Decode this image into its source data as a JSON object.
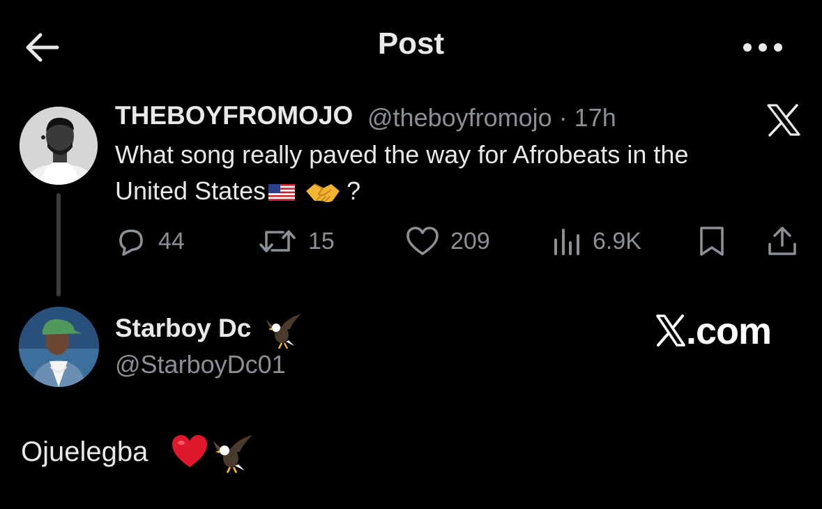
{
  "header": {
    "back_icon": "arrow-left-icon",
    "title": "Post",
    "more_icon": "more-horizontal-icon"
  },
  "parent_post": {
    "display_name": "THEBOYFROMOJO",
    "handle_time": "@theboyfromojo · 17h",
    "text_line1": "What song really paved the way for Afrobeats in the",
    "text_line2_start": "United States",
    "text_line2_end": "?",
    "emojis": [
      "us-flag-icon",
      "handshake-icon"
    ],
    "platform_icon": "x-logo-icon",
    "actions": {
      "replies": "44",
      "reposts": "15",
      "likes": "209",
      "views": "6.9K"
    }
  },
  "reply_post": {
    "display_name": "Starboy Dc",
    "name_emoji": "eagle-icon",
    "handle": "@StarboyDc01",
    "watermark": ".com",
    "text": "Ojuelegba",
    "text_emojis": [
      "red-heart-icon",
      "eagle-icon"
    ]
  },
  "colors": {
    "background": "#000000",
    "primary_text": "#e7e9ea",
    "secondary_text": "#8b9097",
    "thread_line": "#3a3d40",
    "heart": "#e0182d"
  }
}
